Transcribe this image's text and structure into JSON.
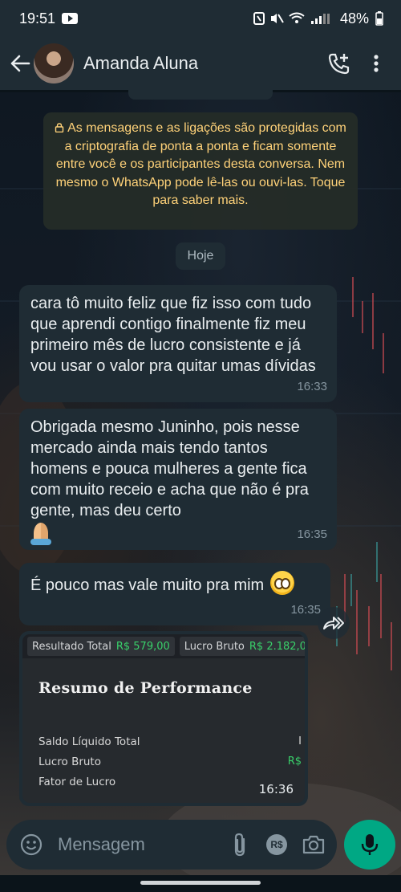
{
  "status": {
    "time": "19:51",
    "battery": "48%"
  },
  "header": {
    "contact_name": "Amanda Aluna",
    "icons": [
      "back-arrow-icon",
      "add-call-icon",
      "more-vert-icon"
    ]
  },
  "chat": {
    "encryption_notice": "As mensagens e as ligações são protegidas com a criptografia de ponta a ponta e ficam somente entre você e os participantes desta conversa. Nem mesmo o WhatsApp pode lê-las ou ouvi-las. Toque para saber mais.",
    "day_label": "Hoje",
    "messages": [
      {
        "text": "cara tô muito feliz que fiz isso com tudo que aprendi contigo finalmente fiz meu primeiro mês de lucro consistente e já vou usar o valor pra quitar umas dívidas",
        "time": "16:33"
      },
      {
        "text": "Obrigada mesmo Juninho, pois nesse mercado ainda mais tendo tantos homens e pouca mulheres a gente fica com muito receio e acha que não é pra gente, mas deu certo",
        "time": "16:35"
      },
      {
        "text": "É pouco mas vale muito pra mim",
        "time": "16:35"
      }
    ],
    "image_message": {
      "time": "16:36",
      "top_pills": [
        {
          "label": "Resultado Total",
          "value": "R$ 579,00"
        },
        {
          "label": "Lucro Bruto",
          "value": "R$ 2.182,0("
        }
      ],
      "title": "Resumo de Performance",
      "rows": [
        {
          "label": "Saldo Líquido Total",
          "value": "I"
        },
        {
          "label": "Lucro Bruto",
          "value": "R$"
        },
        {
          "label": "Fator de Lucro",
          "value": ""
        }
      ]
    }
  },
  "input": {
    "placeholder": "Mensagem",
    "currency_badge": "R$"
  },
  "colors": {
    "accent": "#00a884",
    "bubble": "#1f2c34",
    "notice_text": "#ffd279",
    "profit_green": "#39d06a"
  }
}
